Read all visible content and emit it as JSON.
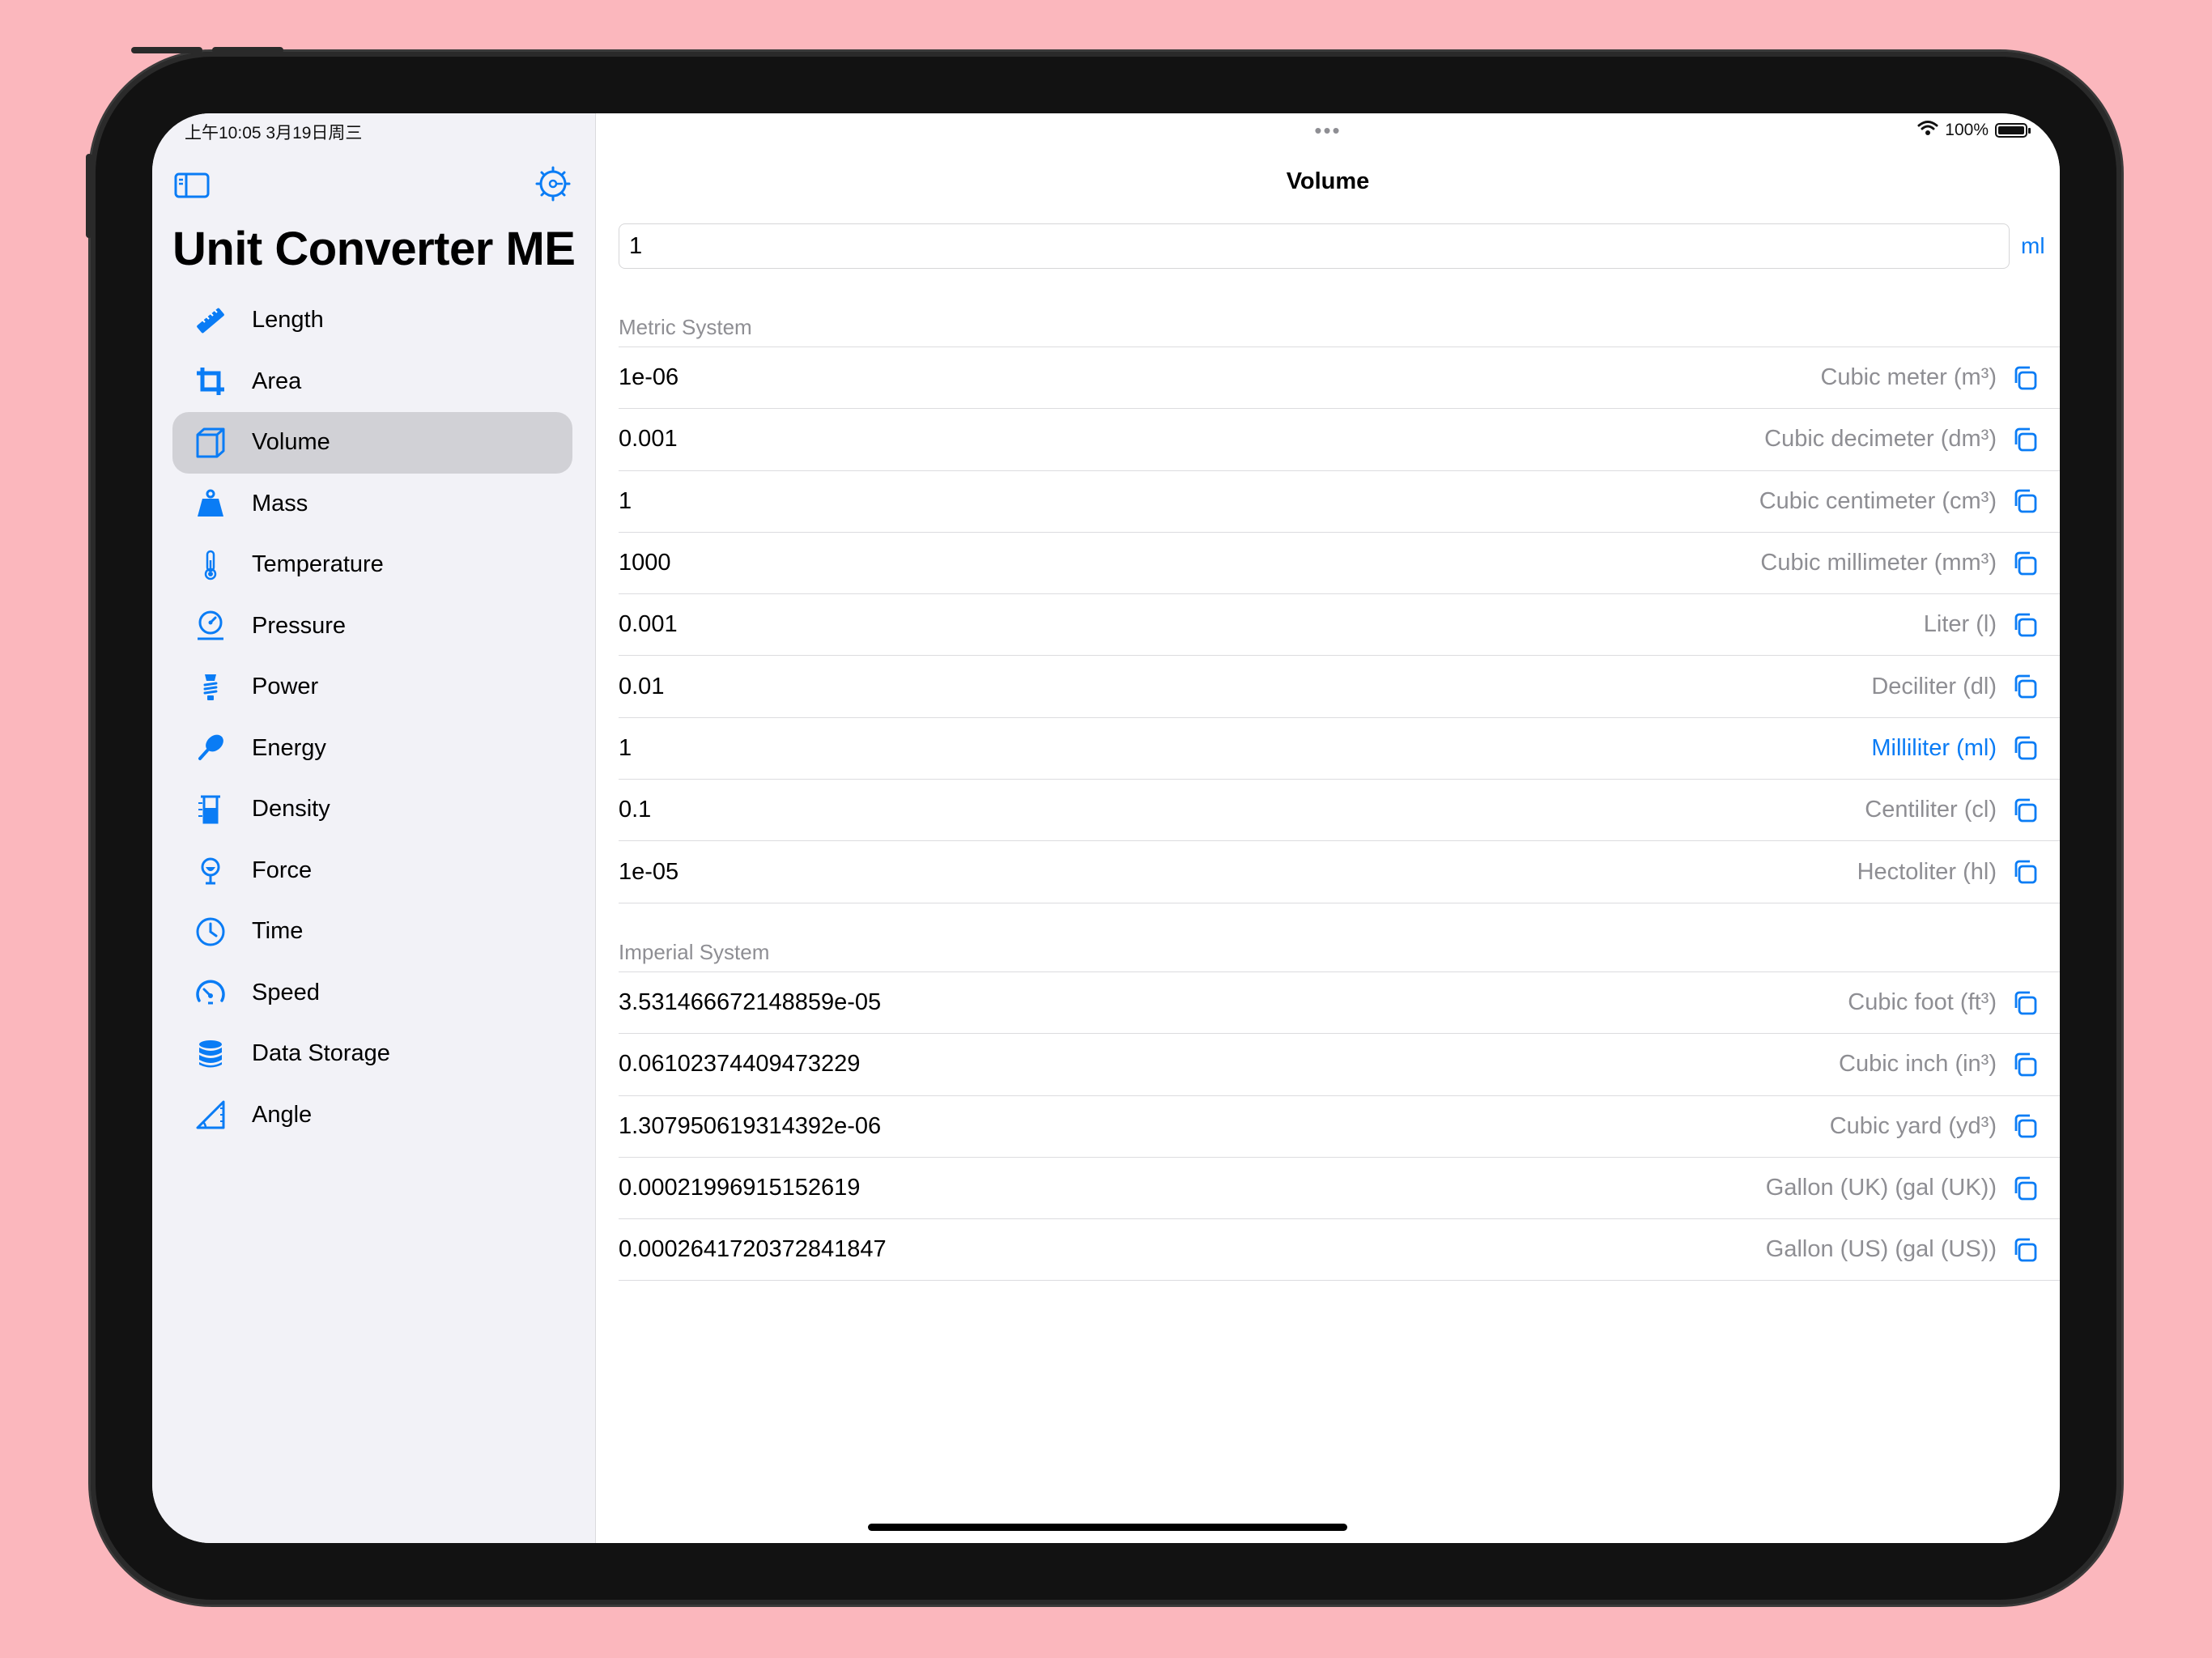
{
  "status": {
    "time_date": "上午10:05   3月19日周三",
    "more_dots": "•••",
    "battery": "100%"
  },
  "sidebar": {
    "title": "Unit Converter ME",
    "items": [
      {
        "label": "Length",
        "icon": "ruler-icon"
      },
      {
        "label": "Area",
        "icon": "crop-icon"
      },
      {
        "label": "Volume",
        "icon": "cube-icon",
        "selected": true
      },
      {
        "label": "Mass",
        "icon": "scale-weight-icon"
      },
      {
        "label": "Temperature",
        "icon": "thermometer-icon"
      },
      {
        "label": "Pressure",
        "icon": "gauge-icon"
      },
      {
        "label": "Power",
        "icon": "bulb-icon"
      },
      {
        "label": "Energy",
        "icon": "drumstick-icon"
      },
      {
        "label": "Density",
        "icon": "beaker-icon"
      },
      {
        "label": "Force",
        "icon": "force-icon"
      },
      {
        "label": "Time",
        "icon": "clock-icon"
      },
      {
        "label": "Speed",
        "icon": "speedometer-icon"
      },
      {
        "label": "Data Storage",
        "icon": "database-icon"
      },
      {
        "label": "Angle",
        "icon": "angle-icon"
      }
    ]
  },
  "detail": {
    "title": "Volume",
    "input_value": "1",
    "input_unit": "ml",
    "metric": {
      "header": "Metric System",
      "rows": [
        {
          "value": "1e-06",
          "unit": "Cubic meter (m³)"
        },
        {
          "value": "0.001",
          "unit": "Cubic decimeter (dm³)"
        },
        {
          "value": "1",
          "unit": "Cubic centimeter (cm³)"
        },
        {
          "value": "1000",
          "unit": "Cubic millimeter (mm³)"
        },
        {
          "value": "0.001",
          "unit": "Liter (l)"
        },
        {
          "value": "0.01",
          "unit": "Deciliter (dl)"
        },
        {
          "value": "1",
          "unit": "Milliliter (ml)",
          "active": true
        },
        {
          "value": "0.1",
          "unit": "Centiliter (cl)"
        },
        {
          "value": "1e-05",
          "unit": "Hectoliter (hl)"
        }
      ]
    },
    "imperial": {
      "header": "Imperial System",
      "rows": [
        {
          "value": "3.531466672148859e-05",
          "unit": "Cubic foot (ft³)"
        },
        {
          "value": "0.06102374409473229",
          "unit": "Cubic inch (in³)"
        },
        {
          "value": "1.307950619314392e-06",
          "unit": "Cubic yard (yd³)"
        },
        {
          "value": "0.00021996915152619",
          "unit": "Gallon (UK) (gal (UK))"
        },
        {
          "value": "0.0002641720372841847",
          "unit": "Gallon (US) (gal (US))"
        }
      ]
    }
  },
  "colors": {
    "accent": "#0a7cf5",
    "background": "#fbb7bd",
    "sidebar_bg": "#f2f2f7",
    "selected_bg": "#d1d1d6",
    "secondary_text": "#8e8e93"
  }
}
